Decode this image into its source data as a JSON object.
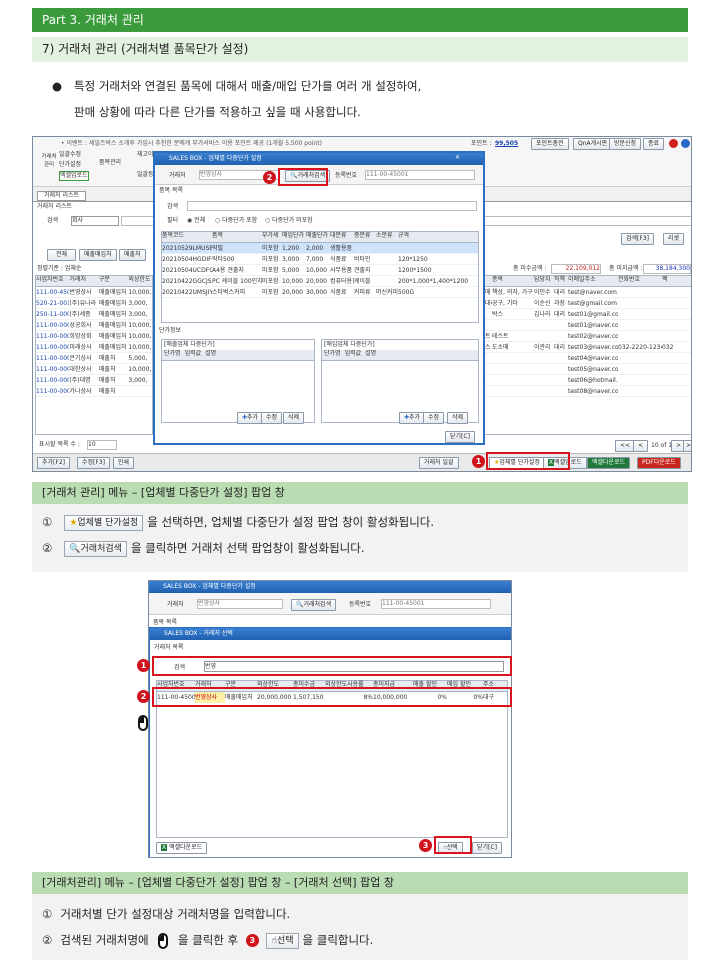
{
  "header": {
    "part": "Part 3. 거래처 관리",
    "section": "7) 거래처 관리 (거래처별 품목단가 설정)"
  },
  "intro": {
    "line1": "특정 거래처와 연결된 품목에 대해서 매출/매입 단가를 여러 개 설정하여,",
    "line2": "판매 상황에 따라 다른 단가를 적용하고 싶을 때 사용합니다."
  },
  "app": {
    "notice": "• 이벤트 : 세일즈박스 소개후 가입시 추천한 분에게 부가서비스 이용 포인트 제공 (1개월 5,500 point)",
    "points_label": "포인트 :",
    "points": "99,505",
    "charge": "포인트충전",
    "qna": "QnA게시판",
    "consult": "방문신청",
    "close": "종료",
    "tab": "거래처 리스트",
    "list_title": "거래처 리스트",
    "search_label": "검색",
    "search_scope": "회사",
    "sidebar": [
      "일괄수정",
      "단가설정",
      "품목관리",
      "재고이동",
      "엑셀업로드",
      "일괄등록"
    ],
    "biz_label": "거래처\n관리",
    "list_btns": [
      "전체",
      "매출매입처",
      "매출처"
    ],
    "sort_label": "정렬기준 : 업체순",
    "grid_cols": [
      "사업자번호",
      "거래처",
      "구분",
      "외상한도"
    ],
    "rows": [
      [
        "111-00-45001",
        "번영상사",
        "매출매입처",
        "10,000,"
      ],
      [
        "520-21-00121",
        "(주)유나라",
        "매출매입처",
        "3,000,"
      ],
      [
        "250-11-00001",
        "(주)세종",
        "매출매입처",
        "3,000,"
      ],
      [
        "111-00-00007",
        "성공회사",
        "매출매입처",
        "10,000,"
      ],
      [
        "111-00-00006",
        "희망상회",
        "매출매입처",
        "10,000,"
      ],
      [
        "111-00-00005",
        "미래상사",
        "매출매입처",
        "10,000,"
      ],
      [
        "111-00-00004",
        "큰기상사",
        "매출처",
        "5,000,"
      ],
      [
        "111-00-00003",
        "대한상사",
        "매출처",
        "10,000,"
      ],
      [
        "111-00-00002",
        "(주)대명",
        "매출처",
        "3,000,"
      ],
      [
        "111-00-00001",
        "가나상사",
        "매출처",
        ""
      ]
    ],
    "right_cols": [
      "업태",
      "종목",
      "담당자",
      "직책",
      "이메일주소",
      "전화번호",
      "팩"
    ],
    "right_rows": [
      [
        "도소매",
        "책상, 의자, 가구 등",
        "이민수",
        "대리",
        "test@naver.com",
        "",
        ""
      ],
      [
        "종합대리",
        "공구, 기타",
        "이순신",
        "과장",
        "test@gmail.com",
        "",
        ""
      ],
      [
        "유통",
        "박스",
        "김나라",
        "대리",
        "test01@gmail.com",
        "",
        ""
      ],
      [
        "",
        "",
        "",
        "",
        "test01@naver.com",
        "",
        ""
      ],
      [
        "테스트",
        "테스트",
        "",
        "",
        "test02@naver.com",
        "",
        ""
      ],
      [
        "서비스",
        "도소매",
        "이관리",
        "대리",
        "test03@naver.com",
        "032-2220-1234",
        "032"
      ],
      [
        "",
        "",
        "",
        "",
        "test04@naver.com",
        "",
        ""
      ],
      [
        "",
        "",
        "",
        "",
        "test05@naver.com",
        "",
        ""
      ],
      [
        "",
        "",
        "",
        "",
        "test06@hotmail.com",
        "",
        ""
      ],
      [
        "",
        "",
        "",
        "",
        "test08@naver.com",
        "",
        ""
      ]
    ],
    "total_receivable_label": "총 미수금액 :",
    "total_receivable": "22,109,012",
    "total_payable_label": "총 미지급액 :",
    "total_payable": "38,184,300",
    "search_btn": "검색[F3]",
    "reset_btn": "리셋",
    "page_size_label": "표시할 목록 수 :",
    "page_size": "10",
    "page_info": "10 of 14",
    "bottom_btns": [
      "추가[F2]",
      "수정[F3]",
      "인쇄"
    ],
    "bottom_right": [
      "거래처 일괄",
      "업체별 단가설정",
      "엑셀업로드",
      "엑셀다운로드",
      "PDF다운로드"
    ]
  },
  "popup1": {
    "title": "SALES BOX - 업체별 다중단가 설정",
    "biz_label": "거래처",
    "biz_value": "번영상사",
    "find_btn": "거래처검색",
    "reg_label": "등록번호",
    "reg_value": "111-00-45001",
    "list_title": "품목 목록",
    "search_label": "검색",
    "filter_label": "필터",
    "filters": [
      "전체",
      "다중단가 포함",
      "다중단가 미포함"
    ],
    "cols": [
      "품목코드",
      "품목",
      "부가세",
      "매입단가",
      "매출단가",
      "대분류",
      "중분류",
      "소분류",
      "규격"
    ],
    "rows": [
      [
        "20210529LMUSBF55",
        "락필",
        "미포함",
        "1,200",
        "2,000",
        "생활용품",
        "",
        "",
        ""
      ],
      [
        "20210504HGDIFG53",
        "락타500",
        "미포함",
        "3,000",
        "7,000",
        "식품료",
        "비타민",
        "",
        "120*1250"
      ],
      [
        "20210504UCDFG28",
        "A4용 견출지",
        "미포함",
        "5,000",
        "10,000",
        "사무용품",
        "견출지",
        "",
        "1200*1500"
      ],
      [
        "20210422GGCJSF08",
        "PC 케이블 100인치",
        "미포함",
        "10,000",
        "20,000",
        "컴퓨터용품",
        "케이블",
        "",
        "200*1,000*1,400*1200"
      ],
      [
        "20210422UMSJIYB5",
        "스타벅스커피",
        "미포함",
        "20,000",
        "30,000",
        "식품료",
        "커피류",
        "머신커피",
        "500G"
      ]
    ],
    "price_title": "단가정보",
    "sales_title": "[매출업체 다중단가]",
    "buy_title": "[매입업체 다중단가]",
    "price_cols": [
      "단가명",
      "입력값",
      "설명"
    ],
    "add": "추가",
    "edit": "수정",
    "del": "삭제",
    "close": "닫기[C]"
  },
  "notes1": {
    "title": "[거래처 관리] 메뉴 – [업체별 다중단가 설정] 팝업 창",
    "n1": "①",
    "n1_btn": "업체별 단가설정",
    "n1_text": "을 선택하면, 업체별 다중단가 설정 팝업 창이 활성화됩니다.",
    "n2": "②",
    "n2_btn": "거래처검색",
    "n2_text": "을 클릭하면 거래처 선택 팝업창이 활성화됩니다."
  },
  "popup2": {
    "title": "SALES BOX - 업체별 다중단가 설정",
    "biz_label": "거래처",
    "biz_value": "번영상사",
    "find_btn": "거래처검색",
    "reg_label": "등록번호",
    "reg_value": "111-00-45001",
    "item_title": "품목 목록",
    "inner_title": "SALES BOX - 거래처 선택",
    "list_title": "거래처 목록",
    "search_label": "검색",
    "search_value": "번영",
    "cols": [
      "사업자번호",
      "거래처",
      "구분",
      "외상한도",
      "총미수금",
      "외상한도사용률",
      "총미지급",
      "매출 할인",
      "매입 할인",
      "주소"
    ],
    "row": [
      "111-00-45001",
      "번영상사",
      "매출매입처",
      "20,000,000",
      "1,507,150",
      "8%",
      "10,000,000",
      "0%",
      "0%",
      "대구"
    ],
    "excel": "엑셀다운로드",
    "select": "선택",
    "close": "닫기[C]"
  },
  "notes2": {
    "title": "[거래처관리] 메뉴 – [업체별 다중단가 설정] 팝업 창 – [거래처 선택] 팝업 창",
    "n1": "①",
    "n1_text": "거래처별 단가 설정대상 거래처명을 입력합니다.",
    "n2": "②",
    "n2_pre": "검색된 거래처명에",
    "n2_mid": "을 클릭한 후",
    "n2_btn": "선택",
    "n2_post": "을 클릭합니다."
  },
  "badges": {
    "b1": "1",
    "b2": "2",
    "b3": "3"
  }
}
